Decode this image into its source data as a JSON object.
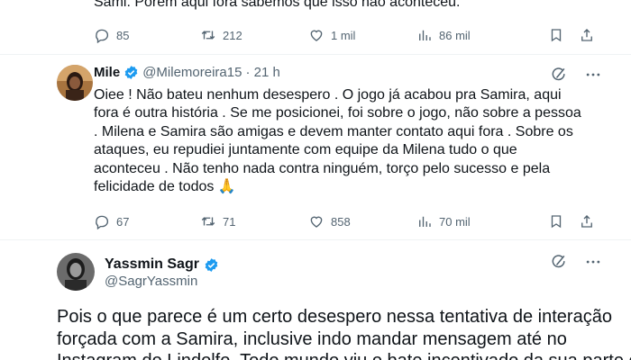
{
  "top_tweet": {
    "text_fragment": "Sami. Porém aqui fora sabemos que isso não aconteceu.",
    "replies": "85",
    "retweets": "212",
    "likes": "1 mil",
    "views": "86 mil"
  },
  "reply_tweet": {
    "name": "Mile",
    "handle": "@Milemoreira15",
    "time": "· 21 h",
    "text_lines": [
      "Oiee ! Não bateu nenhum desespero . O jogo já acabou pra Samira, aqui",
      "fora é outra história . Se me posicionei, foi sobre o jogo, não sobre a pessoa",
      ". Milena e Samira são amigas e devem manter contato aqui fora . Sobre os",
      "ataques, eu repudiei juntamente com equipe da Milena tudo o que",
      "aconteceu . Não tenho nada contra ninguém, torço pelo sucesso e pela",
      "felicidade de todos 🙏"
    ],
    "replies": "67",
    "retweets": "71",
    "likes": "858",
    "views": "70 mil"
  },
  "main_tweet": {
    "name": "Yassmin Sagr",
    "handle": "@SagrYassmin",
    "text_lines": [
      "Pois o que parece é um certo desespero nessa tentativa de interação",
      "forçada com a Samira, inclusive indo mandar mensagem até no",
      "Instagram do Lindolfo. Todo mundo viu o bate incentivado da sua parte o"
    ]
  },
  "colors": {
    "verified": "#1d9bf0",
    "text": "#0f1419",
    "muted": "#536471"
  },
  "icons": [
    "reply-icon",
    "retweet-icon",
    "like-icon",
    "views-icon",
    "bookmark-icon",
    "share-icon",
    "grok-icon",
    "more-icon",
    "verified-badge-icon"
  ]
}
